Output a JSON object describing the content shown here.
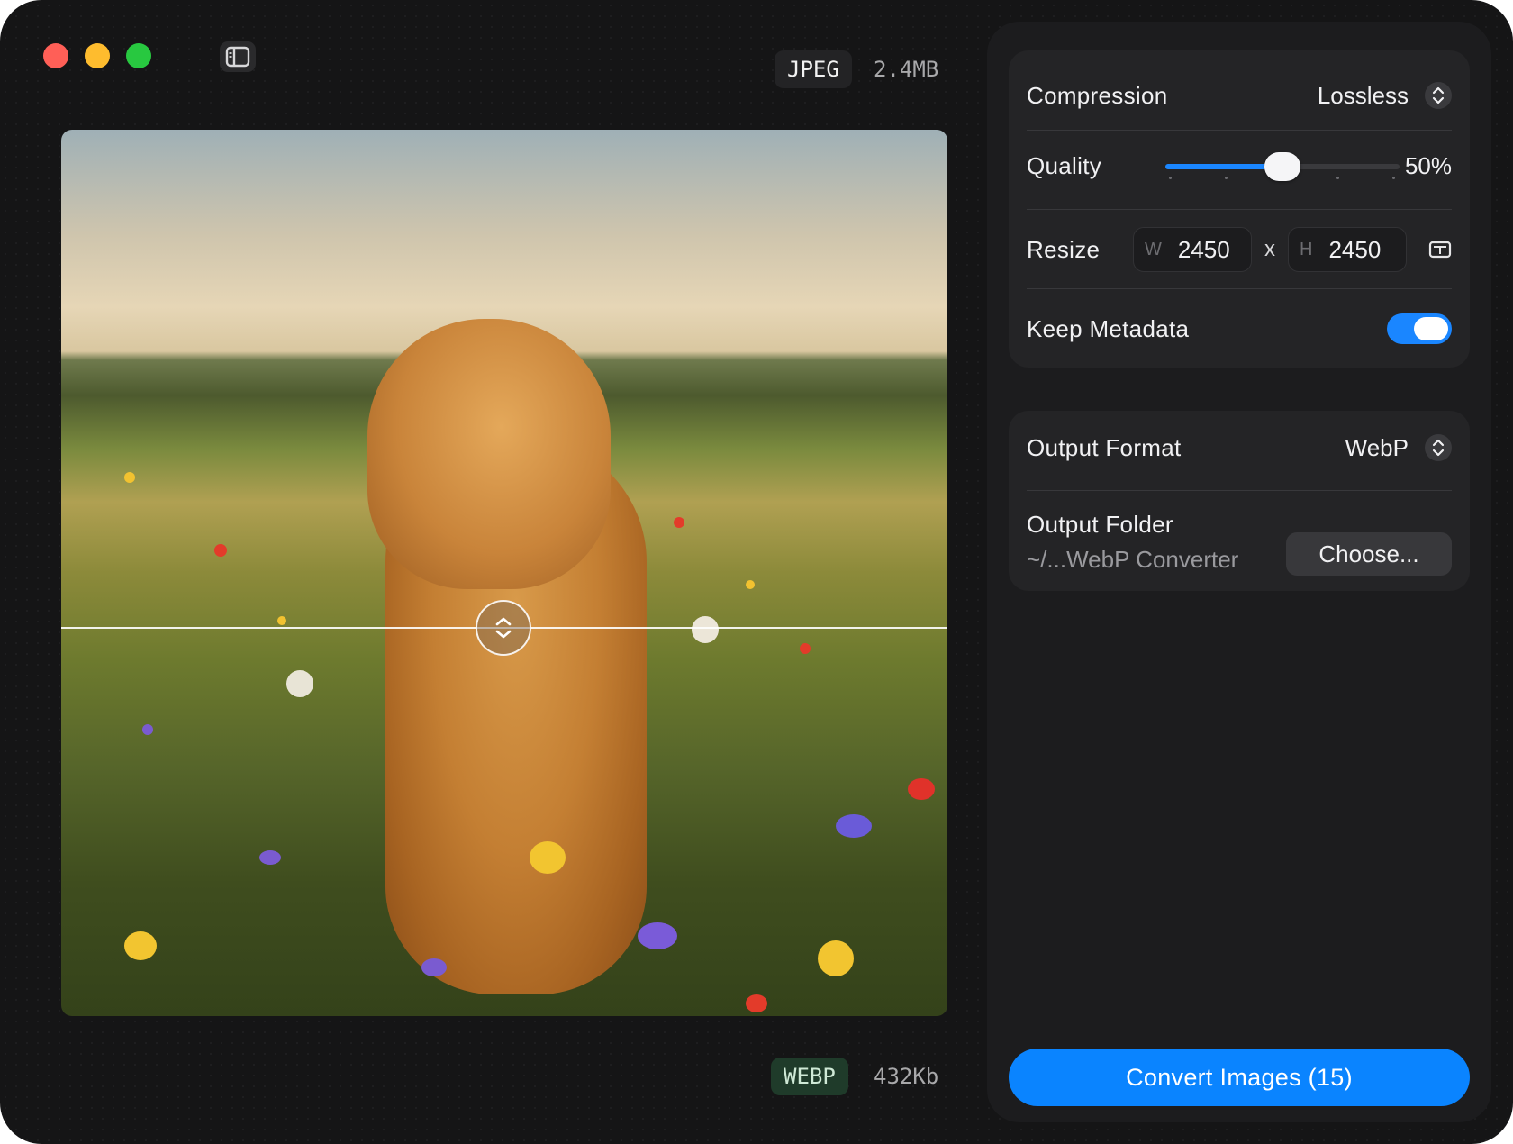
{
  "window": {
    "controls": [
      "close",
      "minimize",
      "zoom"
    ],
    "sidebar_toggle_icon": "sidebar-icon"
  },
  "preview": {
    "original_format": "JPEG",
    "original_size": "2.4MB",
    "converted_format": "WEBP",
    "converted_size": "432Kb",
    "divider_handle_icon": "chevron-up-down-icon",
    "image_alt": "Golden retriever sitting in a wildflower meadow"
  },
  "settings": {
    "compression_label": "Compression",
    "compression_value": "Lossless",
    "quality_label": "Quality",
    "quality_value": "50%",
    "quality_fraction": 0.5,
    "resize_label": "Resize",
    "width_prefix": "W",
    "width_value": "2450",
    "times_sign": "x",
    "height_prefix": "H",
    "height_value": "2450",
    "aspect_icon": "aspect-ratio-icon",
    "metadata_label": "Keep Metadata",
    "metadata_on": true
  },
  "output": {
    "format_label": "Output Format",
    "format_value": "WebP",
    "folder_label": "Output Folder",
    "folder_path": "~/...WebP Converter",
    "choose_label": "Choose..."
  },
  "actions": {
    "convert_label": "Convert Images (15)"
  },
  "colors": {
    "accent": "#0a84ff",
    "close": "#ff5f57",
    "minimize": "#febc2e",
    "zoom": "#28c840",
    "webp_badge": "#1f3b2a"
  }
}
